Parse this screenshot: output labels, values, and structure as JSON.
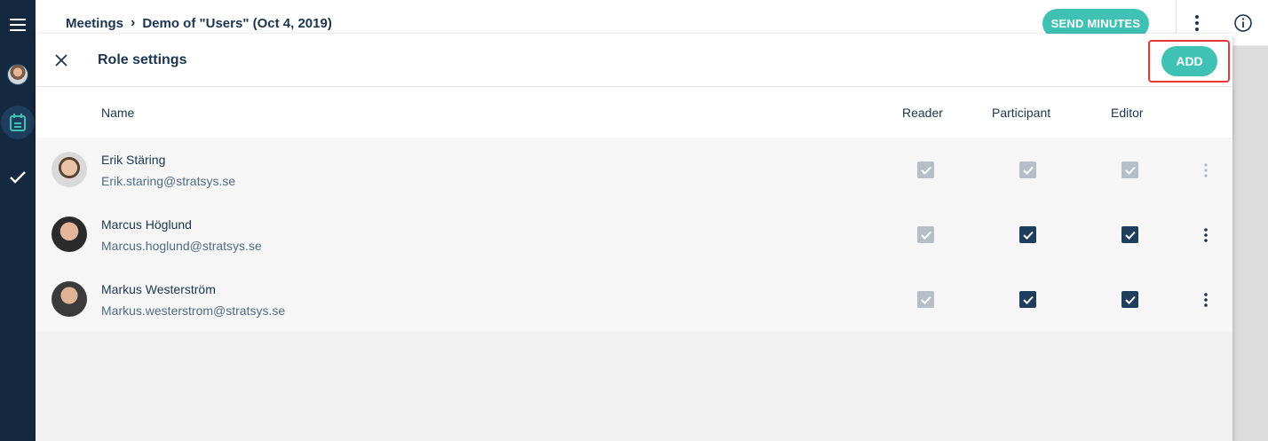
{
  "header": {
    "breadcrumb_root": "Meetings",
    "breadcrumb_current": "Demo of \"Users\" (Oct 4, 2019)",
    "send_minutes_label": "SEND MINUTES"
  },
  "panel": {
    "title": "Role settings",
    "add_label": "ADD",
    "columns": {
      "name": "Name",
      "reader": "Reader",
      "participant": "Participant",
      "editor": "Editor"
    },
    "rows": [
      {
        "name": "Erik Stäring",
        "email": "Erik.staring@stratsys.se",
        "reader": "checked-disabled",
        "participant": "checked-disabled",
        "editor": "checked-disabled"
      },
      {
        "name": "Marcus Höglund",
        "email": "Marcus.hoglund@stratsys.se",
        "reader": "checked-disabled",
        "participant": "checked",
        "editor": "checked"
      },
      {
        "name": "Markus Westerström",
        "email": "Markus.westerstrom@stratsys.se",
        "reader": "checked-disabled",
        "participant": "checked",
        "editor": "checked"
      }
    ]
  },
  "colors": {
    "accent": "#3fc1b4",
    "nav": "#14283f",
    "checkbox_on": "#1f3d5c",
    "checkbox_disabled": "#b6bfc8",
    "highlight": "#e53935"
  },
  "icons": [
    "menu-icon",
    "calendar-icon",
    "checkmark-icon",
    "more-vert-icon",
    "info-icon",
    "close-icon"
  ]
}
